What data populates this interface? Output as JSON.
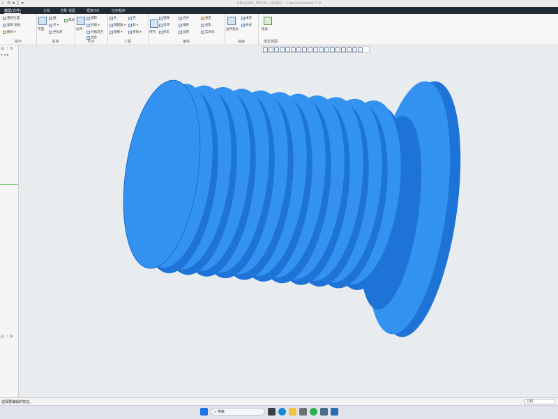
{
  "titlebar": {
    "qat_icons": [
      "✓",
      "⟲",
      "▾",
      "│",
      "▾"
    ],
    "title": "BELLOWS_MODEL (活动的) - Creo Parametric 7.0"
  },
  "tabs": [
    {
      "label": "模型(文件)",
      "active": true
    },
    {
      "label": "分析",
      "active": false
    },
    {
      "label": "注释",
      "active": false
    },
    {
      "label": "视图",
      "active": false
    },
    {
      "label": "框架(M)",
      "active": false
    },
    {
      "label": "应用程序",
      "active": false
    }
  ],
  "ribbon": {
    "groups": [
      {
        "label": "操作",
        "buttons": [
          "重新生成",
          "复制 粘贴",
          "删除 ▾"
        ]
      },
      {
        "label": "基准",
        "buttons": [
          "平面",
          "轴",
          "点 ▾",
          "坐标系",
          "草绘"
        ]
      },
      {
        "label": "形状",
        "buttons": [
          "拉伸",
          "旋转",
          "扫描 ▾",
          "扫描混合",
          "混合"
        ]
      },
      {
        "label": "工程",
        "buttons": [
          "孔",
          "倒圆角 ▾",
          "拔模 ▾",
          "壳",
          "筋 ▾",
          "倒角 ▾"
        ]
      },
      {
        "label": "编辑",
        "buttons": [
          "阵列",
          "镜像",
          "延伸",
          "修剪",
          "合并",
          "偏移",
          "加厚",
          "相交",
          "投影",
          "实体化"
        ]
      },
      {
        "label": "曲面",
        "buttons": [
          "边界混合",
          "填充",
          "样式"
        ]
      },
      {
        "label": "模型意图",
        "buttons": [
          "族表"
        ]
      }
    ]
  },
  "left_panel": {
    "top_icons": [
      "▤",
      "☆",
      "⚙"
    ],
    "bottom_icons": [
      "▤",
      "☆",
      "⚙"
    ]
  },
  "status": {
    "message": "选择要编辑的特征。",
    "filter": "几何"
  },
  "taskbar": {
    "search_placeholder": "搜索"
  },
  "colors": {
    "model_fill": "#2e8ff0",
    "model_mesh": "#5fb4ff",
    "tabbar_bg": "#222b35"
  }
}
